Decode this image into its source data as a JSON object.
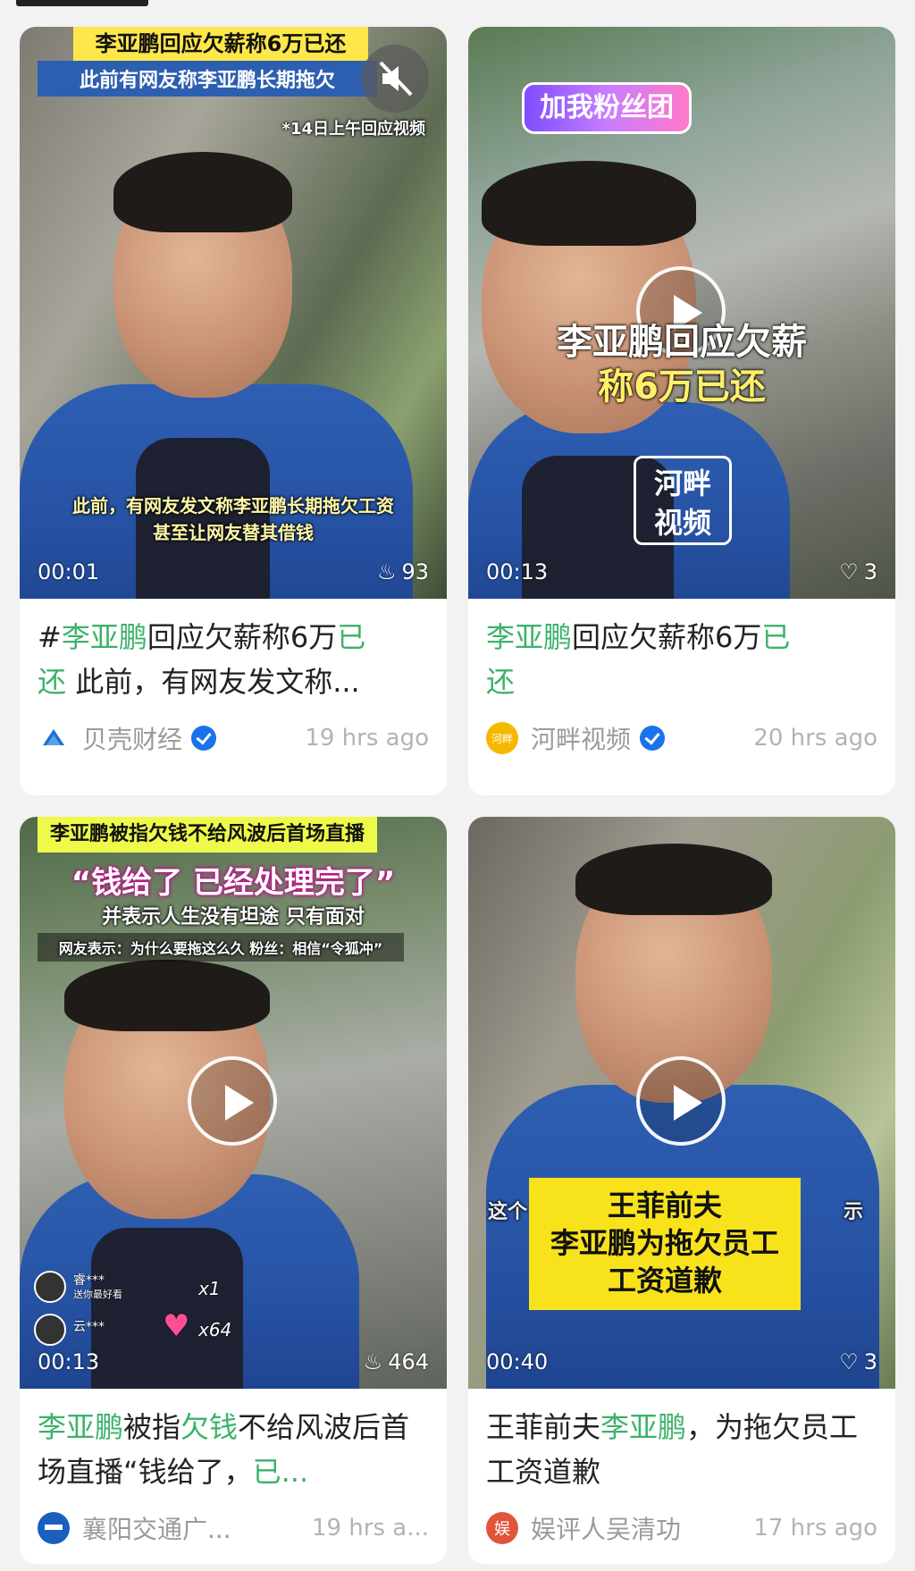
{
  "cards": [
    {
      "overlay_top_1": "李亚鹏回应欠薪称6万已还",
      "overlay_top_2": "此前有网友称李亚鹏长期拖欠",
      "overlay_small": "*14日上午回应视频",
      "overlay_bottom_1": "此前，有网友发文称李亚鹏长期拖欠工资",
      "overlay_bottom_2": "甚至让网友替其借钱",
      "duration": "00:01",
      "stat_icon": "flame-icon",
      "stat_value": "93",
      "title_parts": [
        "#",
        "李亚鹏",
        "回应欠薪称6万",
        "已",
        "还",
        " 此前，有网友发文称..."
      ],
      "source": "贝壳财经",
      "verified": true,
      "time": "19 hrs ago"
    },
    {
      "badge": "加我粉丝团",
      "overlay_center_1": "李亚鹏回应欠薪",
      "overlay_center_2": "称6万已还",
      "logo_1": "河畔",
      "logo_2": "视频",
      "duration": "00:13",
      "stat_icon": "heart-icon",
      "stat_value": "3",
      "title_parts": [
        "李亚鹏",
        "回应欠薪称6万",
        "已",
        "还"
      ],
      "source": "河畔视频",
      "source_icon_text": "河畔",
      "verified": true,
      "time": "20 hrs ago"
    },
    {
      "overlay_top_1": "李亚鹏被指欠钱不给风波后首场直播",
      "overlay_top_2": "“钱给了 已经处理完了”",
      "overlay_top_3": "并表示人生没有坦途 只有面对",
      "overlay_top_4": "网友表示：为什么要拖这么久 粉丝：相信“令狐冲”",
      "comment_1_name": "睿***",
      "comment_1_text": "送你最好看",
      "comment_1_count": "x1",
      "comment_2_name": "云***",
      "comment_2_count": "x64",
      "duration": "00:13",
      "stat_icon": "flame-icon",
      "stat_value": "464",
      "title_parts": [
        "李亚鹏",
        "被指",
        "欠钱",
        "不给风波后首场直播“钱给了，",
        "已..."
      ],
      "source": "襄阳交通广...",
      "verified": false,
      "time": "19 hrs a..."
    },
    {
      "overlay_box_1": "王菲前夫",
      "overlay_box_2": "李亚鹏为拖欠员工",
      "overlay_box_3": "工资道歉",
      "overlay_side_left": "这个",
      "overlay_side_right": "示",
      "duration": "00:40",
      "stat_icon": "heart-icon",
      "stat_value": "3",
      "title_parts": [
        "王菲前夫",
        "李亚鹏",
        "，为拖欠员工工资道歉"
      ],
      "source": "娱评人吴清功",
      "source_icon_text": "娱",
      "verified": false,
      "time": "17 hrs ago"
    }
  ],
  "colors": {
    "highlight": "#3cb26b",
    "verified": "#1a73e8",
    "banner": "#fde74a"
  }
}
